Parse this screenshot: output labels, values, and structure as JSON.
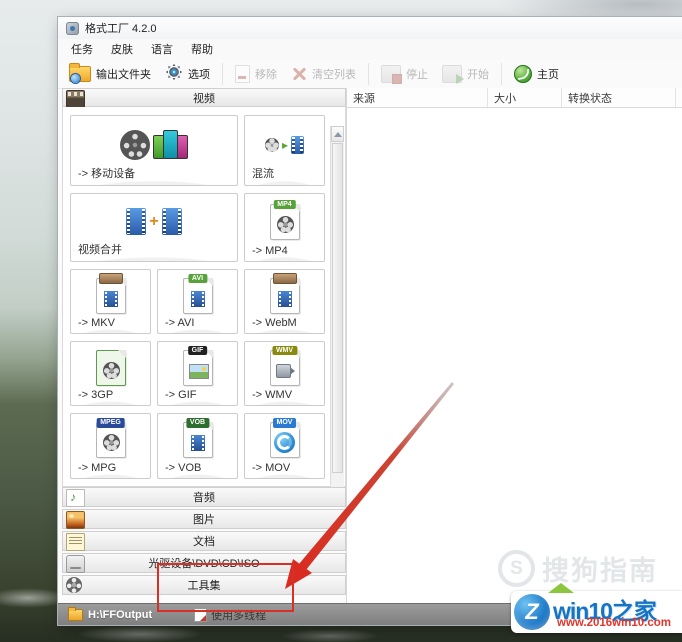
{
  "window": {
    "title": "格式工厂 4.2.0"
  },
  "menubar": {
    "items": [
      "任务",
      "皮肤",
      "语言",
      "帮助"
    ]
  },
  "toolbar": {
    "output_folder": "输出文件夹",
    "options": "选项",
    "remove": "移除",
    "clear_list": "清空列表",
    "stop": "停止",
    "start": "开始",
    "home": "主页"
  },
  "video_panel": {
    "header": "视频",
    "tiles": [
      {
        "label": "-> 移动设备"
      },
      {
        "label": "混流"
      },
      {
        "label": "视频合并"
      },
      {
        "label": "-> MP4",
        "badge": "MP4"
      },
      {
        "label": "-> MKV"
      },
      {
        "label": "-> AVI",
        "badge": "AVI"
      },
      {
        "label": "-> WebM"
      },
      {
        "label": "-> 3GP"
      },
      {
        "label": "-> GIF",
        "badge": "GIF"
      },
      {
        "label": "-> WMV",
        "badge": "WMV"
      },
      {
        "label": "-> MPG",
        "badge": "MPEG"
      },
      {
        "label": "-> VOB",
        "badge": "VOB"
      },
      {
        "label": "-> MOV",
        "badge": "MOV"
      }
    ]
  },
  "category_bars": {
    "audio": "音频",
    "picture": "图片",
    "document": "文档",
    "rom_device": "光驱设备\\DVD\\CD\\ISO",
    "toolset": "工具集"
  },
  "file_table": {
    "columns": {
      "source": "来源",
      "size": "大小",
      "status": "转换状态"
    }
  },
  "status_bar": {
    "output_path": "H:\\FFOutput",
    "multithread": "使用多线程"
  },
  "watermarks": {
    "sogou_initial": "S",
    "sogou_label": "搜狗指南",
    "win10_letter": "Z",
    "win10_name": "win10之家",
    "win10_url": "www.2016win10.com"
  },
  "colors": {
    "annotation_red": "#d93025",
    "win10_blue": "#1574c4",
    "url_red": "#e2362b",
    "status_gray": "#8a8a8a"
  }
}
